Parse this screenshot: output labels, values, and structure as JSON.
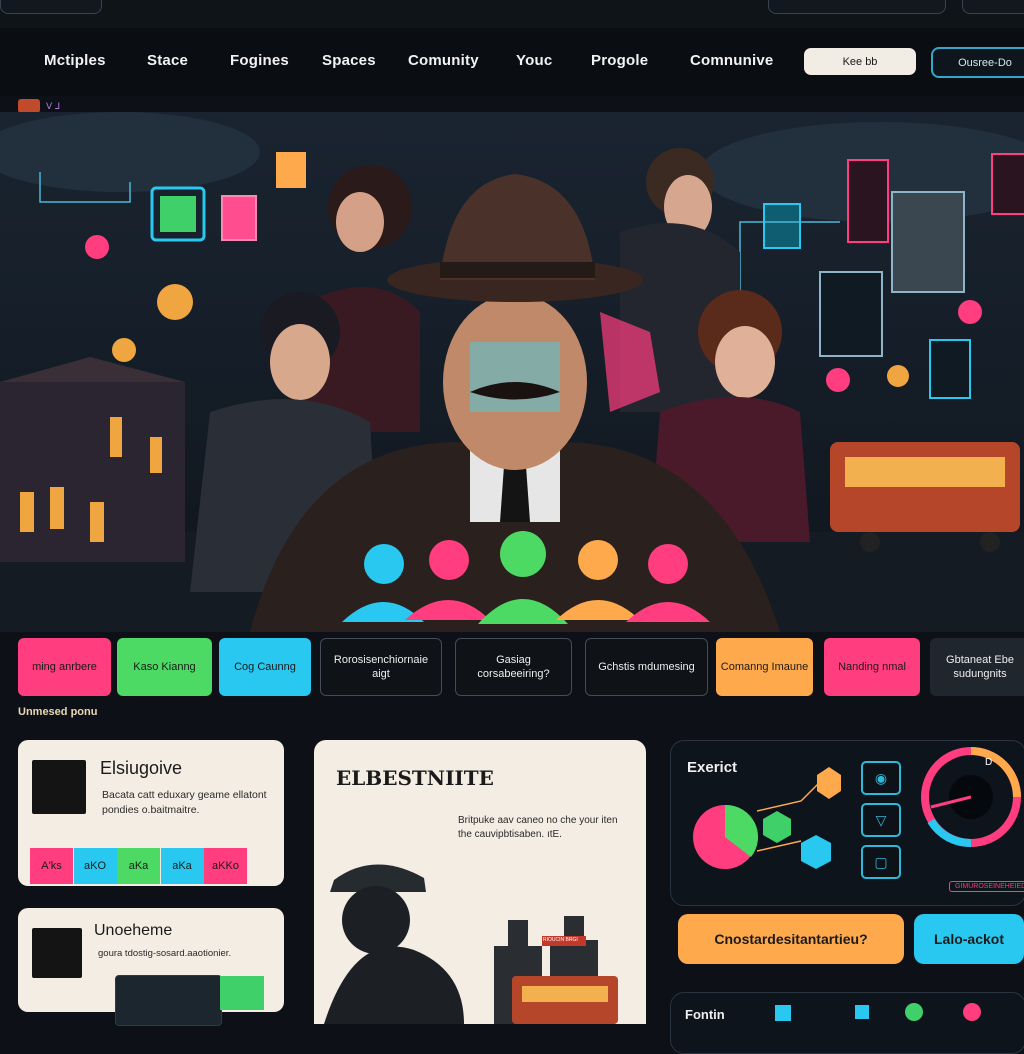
{
  "nav": {
    "items": [
      "Mctiples",
      "Stace",
      "Fogines",
      "Spaces",
      "Comunity",
      "Youc",
      "Progole",
      "Comnunive"
    ],
    "light_button": "Kee bb",
    "outline_button": "Ousree-Do"
  },
  "subbar": {
    "text": "ᐯ ᒧ"
  },
  "categories": [
    {
      "label": "ming anrbere",
      "color": "#ff3d7f",
      "style": "solid"
    },
    {
      "label": "Kaso Kianng",
      "color": "#4cd964",
      "style": "solid"
    },
    {
      "label": "Cog Caunng",
      "color": "#28c8f0",
      "style": "solid"
    },
    {
      "label": "Rorosisenchiornaie aigt",
      "style": "dark"
    },
    {
      "label": "Gasiag corsabeeiring?",
      "style": "dark"
    },
    {
      "label": "Gchstis mdumesing",
      "style": "dark"
    },
    {
      "label": "Comanng Imaune",
      "color": "#ffa94d",
      "style": "solid"
    },
    {
      "label": "Nanding nmal",
      "color": "#ff3d7f",
      "style": "solid"
    },
    {
      "label": "Gbtaneat Ebe sudungnits",
      "color": "#20262e",
      "style": "darkfill"
    }
  ],
  "section_label": "Unmesed ponu",
  "card1": {
    "title": "Elsiugoive",
    "body": "Bacata catt eduxary geame ellatont pondies o.baitmaitre.",
    "chips": [
      {
        "label": "A'ks",
        "color": "#ff3d7f"
      },
      {
        "label": "aKO",
        "color": "#28c8f0"
      },
      {
        "label": "aKa",
        "color": "#4cd964"
      },
      {
        "label": "aKa",
        "color": "#28c8f0"
      },
      {
        "label": "aKKo",
        "color": "#ff3d7f"
      }
    ]
  },
  "card2": {
    "title": "Unoeheme",
    "body": "goura tdostig-sosard.aaotionier."
  },
  "feature": {
    "title": "ELBESTNIITE",
    "body": "Britpuke aav caneo no che your iten the cauvipbtisaben. ıtE.",
    "sign": "RIOUCIN BRGI"
  },
  "panel": {
    "title": "Exerict",
    "badge": "GIMUROSEINEHEIED",
    "pie": {
      "pink": 0.55,
      "green": 0.45
    }
  },
  "ctas": {
    "orange": "Cnostardesitantartieu?",
    "blue": "Lalo-ackot"
  },
  "bottom_panel": {
    "title": "Fontin"
  },
  "dial_label": "D"
}
